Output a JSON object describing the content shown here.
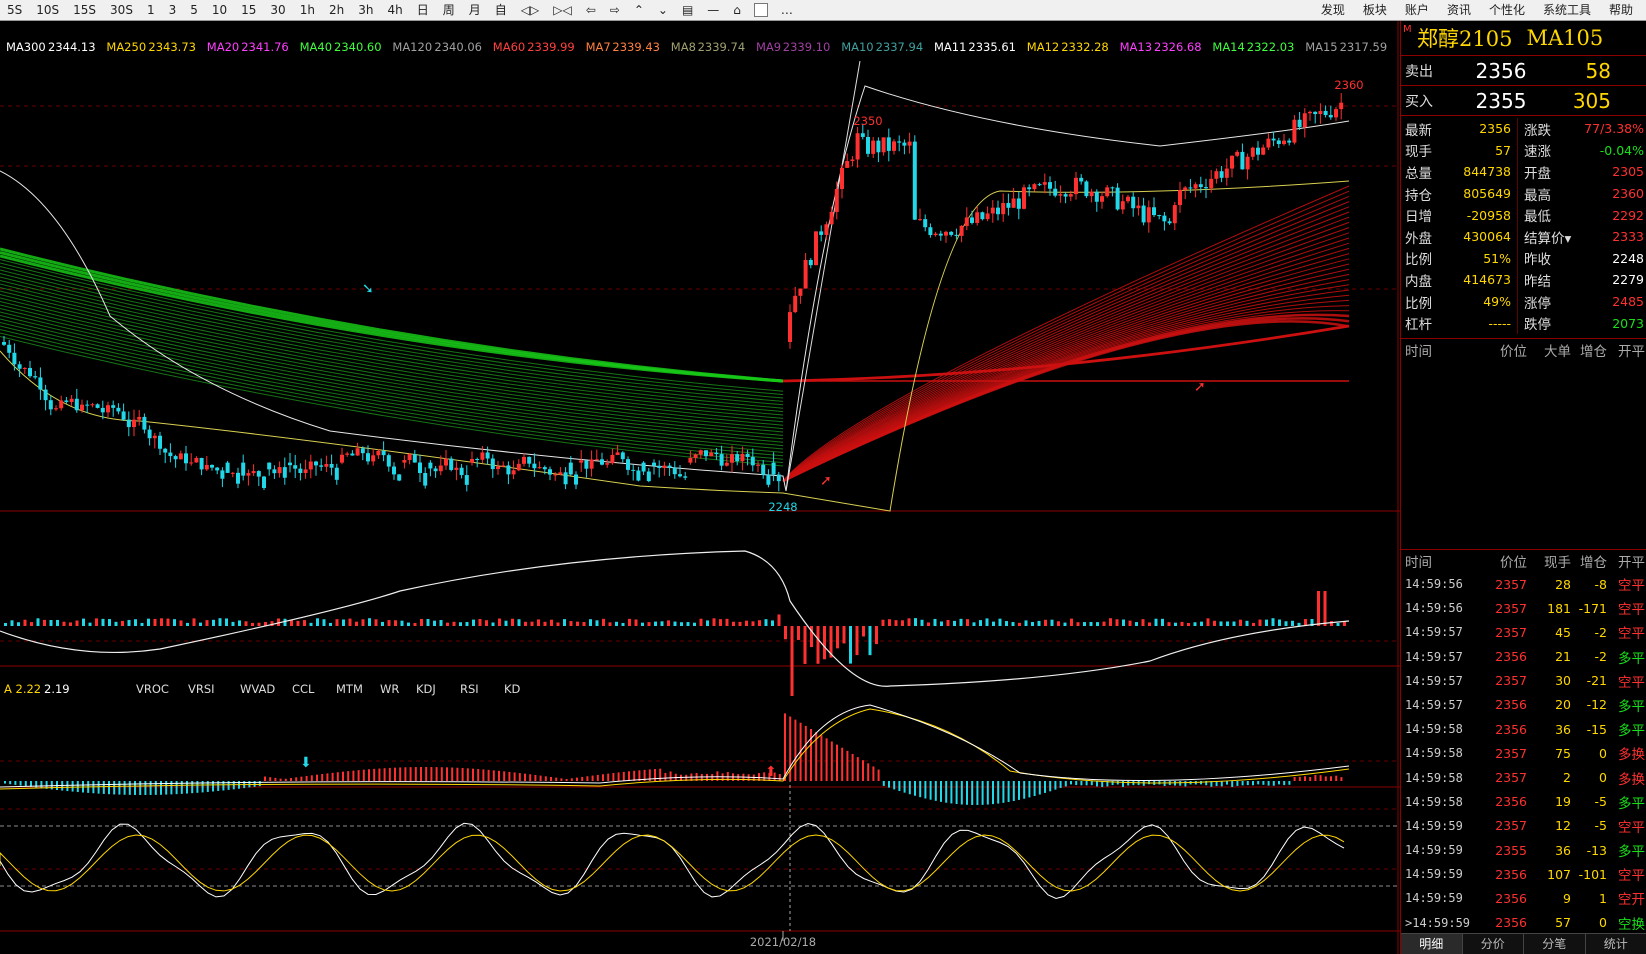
{
  "toolbar": {
    "periods": [
      "5S",
      "10S",
      "15S",
      "30S",
      "1",
      "3",
      "5",
      "10",
      "15",
      "30",
      "1h",
      "2h",
      "3h",
      "4h",
      "日",
      "周",
      "月",
      "自",
      "◁▷",
      "▷◁",
      "⇦",
      "⇨",
      "⌃",
      "⌄",
      "▤",
      "—",
      "⌂"
    ],
    "menus": [
      "发现",
      "板块",
      "账户",
      "资讯",
      "个性化",
      "系统工具",
      "帮助"
    ],
    "more": "…"
  },
  "ma_legend": [
    {
      "name": "MA300",
      "value": "2344.13",
      "color": "#ffffff"
    },
    {
      "name": "MA250",
      "value": "2343.73",
      "color": "#ffd700"
    },
    {
      "name": "MA20",
      "value": "2341.76",
      "color": "#ff40ff"
    },
    {
      "name": "MA40",
      "value": "2340.60",
      "color": "#40ff40"
    },
    {
      "name": "MA120",
      "value": "2340.06",
      "color": "#a0a0a0"
    },
    {
      "name": "MA60",
      "value": "2339.99",
      "color": "#ff4040"
    },
    {
      "name": "MA7",
      "value": "2339.43",
      "color": "#ff8040"
    },
    {
      "name": "MA8",
      "value": "2339.74",
      "color": "#a0a070"
    },
    {
      "name": "MA9",
      "value": "2339.10",
      "color": "#a040a0"
    },
    {
      "name": "MA10",
      "value": "2337.94",
      "color": "#40a0a0"
    },
    {
      "name": "MA11",
      "value": "2335.61",
      "color": "#ffffff"
    },
    {
      "name": "MA12",
      "value": "2332.28",
      "color": "#ffd700"
    },
    {
      "name": "MA13",
      "value": "2326.68",
      "color": "#ff40ff"
    },
    {
      "name": "MA14",
      "value": "2322.03",
      "color": "#40ff40"
    },
    {
      "name": "MA15",
      "value": "2317.59",
      "color": "#a0a0a0"
    }
  ],
  "price_labels": {
    "high_right": "2360",
    "high_mid": "2350",
    "low": "2248"
  },
  "indicator_bar": {
    "values": [
      "A 2.22",
      "2.19"
    ],
    "tabs": [
      "VROC",
      "VRSI",
      "WVAD",
      "CCL",
      "MTM",
      "WR",
      "KDJ",
      "RSI",
      "KD"
    ]
  },
  "x_axis_date": "2021/02/18",
  "quote": {
    "title_prefix": "M",
    "code": "郑醇2105",
    "indicator": "MA105",
    "ask": {
      "label": "卖出",
      "price": "2356",
      "volume": "58"
    },
    "bid": {
      "label": "买入",
      "price": "2355",
      "volume": "305"
    },
    "stats": [
      {
        "l1": "最新",
        "v1": "2356",
        "c1": "red",
        "l2": "涨跌",
        "v2": "77/3.38%",
        "c2": "red"
      },
      {
        "l1": "现手",
        "v1": "57",
        "c1": "yellow",
        "l2": "速涨",
        "v2": "-0.04%",
        "c2": "green"
      },
      {
        "l1": "总量",
        "v1": "844738",
        "c1": "yellow",
        "l2": "开盘",
        "v2": "2305",
        "c2": "red"
      },
      {
        "l1": "持仓",
        "v1": "805649",
        "c1": "yellow",
        "l2": "最高",
        "v2": "2360",
        "c2": "red"
      },
      {
        "l1": "日增",
        "v1": "-20958",
        "c1": "yellow",
        "l2": "最低",
        "v2": "2292",
        "c2": "red"
      },
      {
        "l1": "外盘",
        "v1": "430064",
        "c1": "yellow",
        "l2": "结算价▾",
        "v2": "2333",
        "c2": "red"
      },
      {
        "l1": "比例",
        "v1": "51%",
        "c1": "yellow",
        "l2": "昨收",
        "v2": "2248",
        "c2": "white"
      },
      {
        "l1": "内盘",
        "v1": "414673",
        "c1": "yellow",
        "l2": "昨结",
        "v2": "2279",
        "c2": "white"
      },
      {
        "l1": "比例",
        "v1": "49%",
        "c1": "yellow",
        "l2": "涨停",
        "v2": "2485",
        "c2": "red"
      },
      {
        "l1": "杠杆",
        "v1": "-----",
        "c1": "yellow",
        "l2": "跌停",
        "v2": "2073",
        "c2": "green"
      }
    ],
    "bigorder_header": [
      "时间",
      "价位",
      "大单",
      "增仓",
      "开平"
    ],
    "tick_header": [
      "时间",
      "价位",
      "现手",
      "增仓",
      "开平"
    ],
    "ticks": [
      {
        "time": "14:59:56",
        "price": "2357",
        "qty": "28",
        "chg": "-8",
        "type": "空平",
        "tc": "red"
      },
      {
        "time": "14:59:56",
        "price": "2357",
        "qty": "181",
        "chg": "-171",
        "type": "空平",
        "tc": "red"
      },
      {
        "time": "14:59:57",
        "price": "2357",
        "qty": "45",
        "chg": "-2",
        "type": "空平",
        "tc": "red"
      },
      {
        "time": "14:59:57",
        "price": "2356",
        "qty": "21",
        "chg": "-2",
        "type": "多平",
        "tc": "green"
      },
      {
        "time": "14:59:57",
        "price": "2357",
        "qty": "30",
        "chg": "-21",
        "type": "空平",
        "tc": "red"
      },
      {
        "time": "14:59:57",
        "price": "2356",
        "qty": "20",
        "chg": "-12",
        "type": "多平",
        "tc": "green"
      },
      {
        "time": "14:59:58",
        "price": "2356",
        "qty": "36",
        "chg": "-15",
        "type": "多平",
        "tc": "green"
      },
      {
        "time": "14:59:58",
        "price": "2357",
        "qty": "75",
        "chg": "0",
        "type": "多换",
        "tc": "red"
      },
      {
        "time": "14:59:58",
        "price": "2357",
        "qty": "2",
        "chg": "0",
        "type": "多换",
        "tc": "red"
      },
      {
        "time": "14:59:58",
        "price": "2356",
        "qty": "19",
        "chg": "-5",
        "type": "多平",
        "tc": "green"
      },
      {
        "time": "14:59:59",
        "price": "2357",
        "qty": "12",
        "chg": "-5",
        "type": "空平",
        "tc": "red"
      },
      {
        "time": "14:59:59",
        "price": "2355",
        "qty": "36",
        "chg": "-13",
        "type": "多平",
        "tc": "green"
      },
      {
        "time": "14:59:59",
        "price": "2356",
        "qty": "107",
        "chg": "-101",
        "type": "空平",
        "tc": "red"
      },
      {
        "time": "14:59:59",
        "price": "2356",
        "qty": "9",
        "chg": "1",
        "type": "空开",
        "tc": "red"
      },
      {
        "time": ">14:59:59",
        "price": "2356",
        "qty": "57",
        "chg": "0",
        "type": "空换",
        "tc": "green"
      }
    ],
    "tabs": [
      "明细",
      "分价",
      "分笔",
      "统计"
    ]
  },
  "colors": {
    "up": "#ff3030",
    "down": "#22d8e8",
    "grid": "#8b0000",
    "bg": "#000000"
  }
}
